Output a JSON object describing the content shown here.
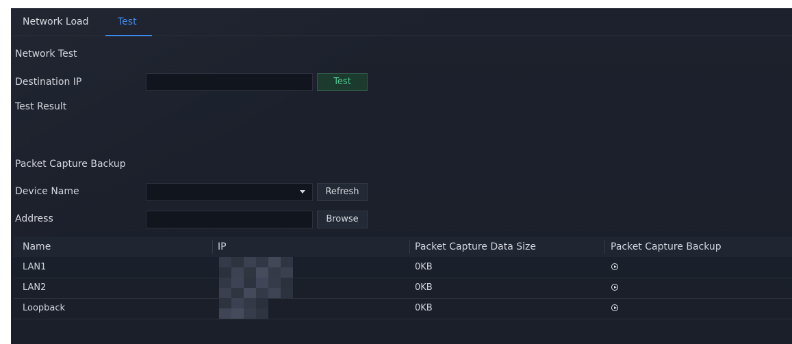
{
  "tabs": [
    {
      "label": "Network Load",
      "active": false
    },
    {
      "label": "Test",
      "active": true
    }
  ],
  "network_test": {
    "section_title": "Network Test",
    "destination_ip_label": "Destination IP",
    "destination_ip_value": "",
    "test_button": "Test",
    "test_result_label": "Test Result"
  },
  "packet_capture": {
    "section_title": "Packet Capture Backup",
    "device_name_label": "Device Name",
    "device_name_value": "",
    "refresh_button": "Refresh",
    "address_label": "Address",
    "address_value": "",
    "browse_button": "Browse"
  },
  "table": {
    "columns": [
      "Name",
      "IP",
      "Packet Capture Data Size",
      "Packet Capture Backup"
    ],
    "rows": [
      {
        "name": "LAN1",
        "ip": "",
        "size": "0KB",
        "action_icon": "play-circle-icon"
      },
      {
        "name": "LAN2",
        "ip": "",
        "size": "0KB",
        "action_icon": "play-circle-icon"
      },
      {
        "name": "Loopback",
        "ip": "",
        "size": "0KB",
        "action_icon": "play-circle-icon"
      }
    ]
  },
  "colors": {
    "accent_blue": "#3f88e8",
    "test_button_green": "#4bc48f",
    "background": "#1b202b"
  }
}
